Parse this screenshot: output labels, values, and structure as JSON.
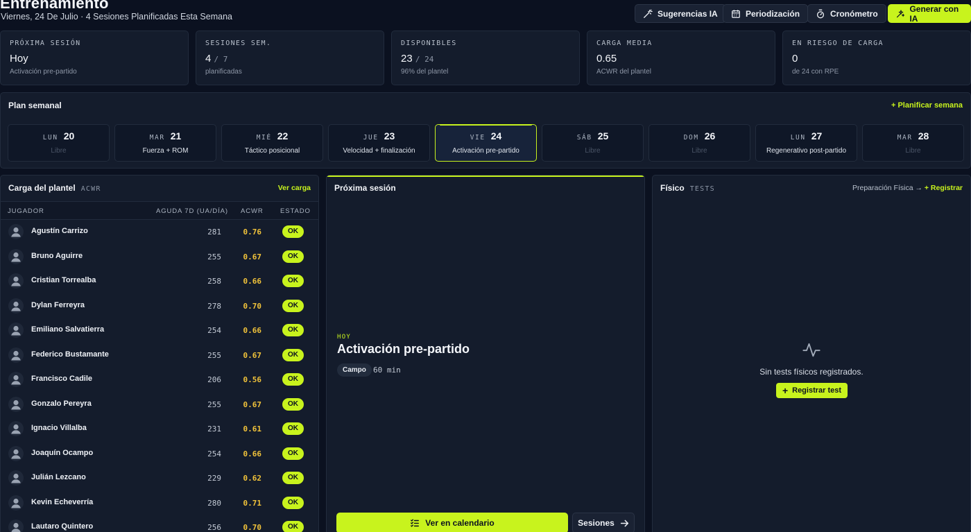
{
  "header": {
    "title": "Entrenamiento",
    "subtitle": "Viernes, 24 De Julio · 4 Sesiones Planificadas Esta Semana",
    "buttons": {
      "suggestions": "Sugerencias IA",
      "periodization": "Periodización",
      "stopwatch": "Cronómetro",
      "generate": "Generar con IA"
    }
  },
  "stats": [
    {
      "label": "PRÓXIMA SESIÓN",
      "value": "Hoy",
      "of": "",
      "sub": "Activación pre-partido"
    },
    {
      "label": "SESIONES SEM.",
      "value": "4",
      "of": "/ 7",
      "sub": "planificadas"
    },
    {
      "label": "DISPONIBLES",
      "value": "23",
      "of": "/ 24",
      "sub": "96% del plantel"
    },
    {
      "label": "CARGA MEDIA",
      "value": "0.65",
      "of": "",
      "sub": "ACWR del plantel"
    },
    {
      "label": "EN RIESGO DE CARGA",
      "value": "0",
      "of": "",
      "sub": "de 24 con RPE"
    }
  ],
  "plan": {
    "title": "Plan semanal",
    "action": "Planificar semana",
    "days": [
      {
        "name": "LUN",
        "date": "20",
        "label": "Libre"
      },
      {
        "name": "MAR",
        "date": "21",
        "label": "Fuerza + ROM"
      },
      {
        "name": "MIÉ",
        "date": "22",
        "label": "Táctico posicional"
      },
      {
        "name": "JUE",
        "date": "23",
        "label": "Velocidad + finalización"
      },
      {
        "name": "VIE",
        "date": "24",
        "label": "Activación pre-partido"
      },
      {
        "name": "SÁB",
        "date": "25",
        "label": "Libre"
      },
      {
        "name": "DOM",
        "date": "26",
        "label": "Libre"
      },
      {
        "name": "LUN",
        "date": "27",
        "label": "Regenerativo post-partido"
      },
      {
        "name": "MAR",
        "date": "28",
        "label": "Libre"
      }
    ]
  },
  "load": {
    "title": "Carga del plantel",
    "tag": "ACWR",
    "link": "Ver carga",
    "columns": {
      "player": "JUGADOR",
      "acute": "AGUDA 7D (UA/DÍA)",
      "acwr": "ACWR",
      "status": "ESTADO"
    },
    "rows": [
      {
        "name": "Agustín Carrizo",
        "acute": "281",
        "acwr": "0.76",
        "status": "OK"
      },
      {
        "name": "Bruno Aguirre",
        "acute": "255",
        "acwr": "0.67",
        "status": "OK"
      },
      {
        "name": "Cristian Torrealba",
        "acute": "258",
        "acwr": "0.66",
        "status": "OK"
      },
      {
        "name": "Dylan Ferreyra",
        "acute": "278",
        "acwr": "0.70",
        "status": "OK"
      },
      {
        "name": "Emiliano Salvatierra",
        "acute": "254",
        "acwr": "0.66",
        "status": "OK"
      },
      {
        "name": "Federico Bustamante",
        "acute": "255",
        "acwr": "0.67",
        "status": "OK"
      },
      {
        "name": "Francisco Cadile",
        "acute": "206",
        "acwr": "0.56",
        "status": "OK"
      },
      {
        "name": "Gonzalo Pereyra",
        "acute": "255",
        "acwr": "0.67",
        "status": "OK"
      },
      {
        "name": "Ignacio Villalba",
        "acute": "231",
        "acwr": "0.61",
        "status": "OK"
      },
      {
        "name": "Joaquín Ocampo",
        "acute": "254",
        "acwr": "0.66",
        "status": "OK"
      },
      {
        "name": "Julián Lezcano",
        "acute": "229",
        "acwr": "0.62",
        "status": "OK"
      },
      {
        "name": "Kevin Echeverría",
        "acute": "280",
        "acwr": "0.71",
        "status": "OK"
      },
      {
        "name": "Lautaro Quintero",
        "acute": "256",
        "acwr": "0.70",
        "status": "OK"
      }
    ]
  },
  "next_session": {
    "title": "Próxima sesión",
    "kicker": "HOY",
    "name": "Activación pre-partido",
    "chip": "Campo",
    "duration": "60 min",
    "calendar_button": "Ver en calendario",
    "sessions_button": "Sesiones"
  },
  "physical": {
    "title": "Físico",
    "tag": "TESTS",
    "link_prep": "Preparación Física",
    "link_register": "Registrar",
    "empty_text": "Sin tests físicos registrados.",
    "register_button": "Registrar test"
  },
  "colors": {
    "accent": "#c8f31d",
    "acwr": "#f0c23a",
    "background": "#0b1120",
    "panel": "#141c2c"
  }
}
